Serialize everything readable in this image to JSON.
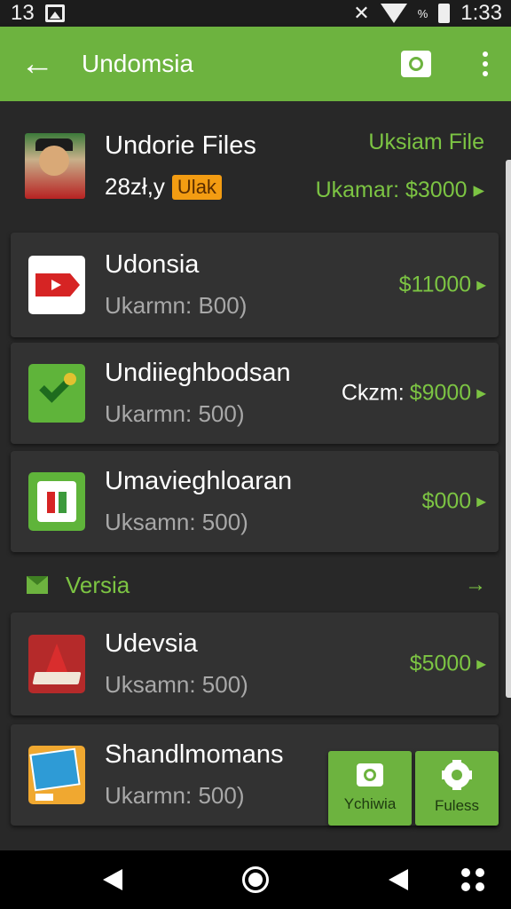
{
  "status_bar": {
    "left_text": "13",
    "battery_pct": "%",
    "time": "1:33"
  },
  "app_bar": {
    "title": "Undomsia"
  },
  "header_item": {
    "title": "Undorie Files",
    "subtitle": "28zł,y",
    "badge": "Ulak",
    "link": "Uksiam File",
    "price": "Ukamar: $3000 ▸"
  },
  "cards": [
    {
      "title": "Udonsia",
      "subtitle": "Ukarmn: B00)",
      "price_prefix": "",
      "price": "$11000",
      "icon": "video-play-icon"
    },
    {
      "title": "Undiieghbodsan",
      "subtitle": "Ukarmn: 500)",
      "price_prefix": "Ckzm: ",
      "price": "$9000",
      "icon": "check-app-icon"
    },
    {
      "title": "Umavieghloaran",
      "subtitle": "Uksamn: 500)",
      "price_prefix": "",
      "price": "$000",
      "icon": "flag-app-icon"
    }
  ],
  "section": {
    "title": "Versia"
  },
  "cards2": [
    {
      "title": "Udevsia",
      "subtitle": "Uksamn: 500)",
      "price": "$5000",
      "icon": "book-app-icon"
    },
    {
      "title": "Shandlmomans",
      "subtitle": "Ukarmn: 500)",
      "icon": "chart-app-icon"
    }
  ],
  "actions": {
    "camera_label": "Ychiwia",
    "settings_label": "Fuless"
  },
  "colors": {
    "accent": "#6db33f",
    "accent_text": "#7cc443",
    "background": "#282828",
    "card": "#323232",
    "badge": "#f39c12"
  }
}
